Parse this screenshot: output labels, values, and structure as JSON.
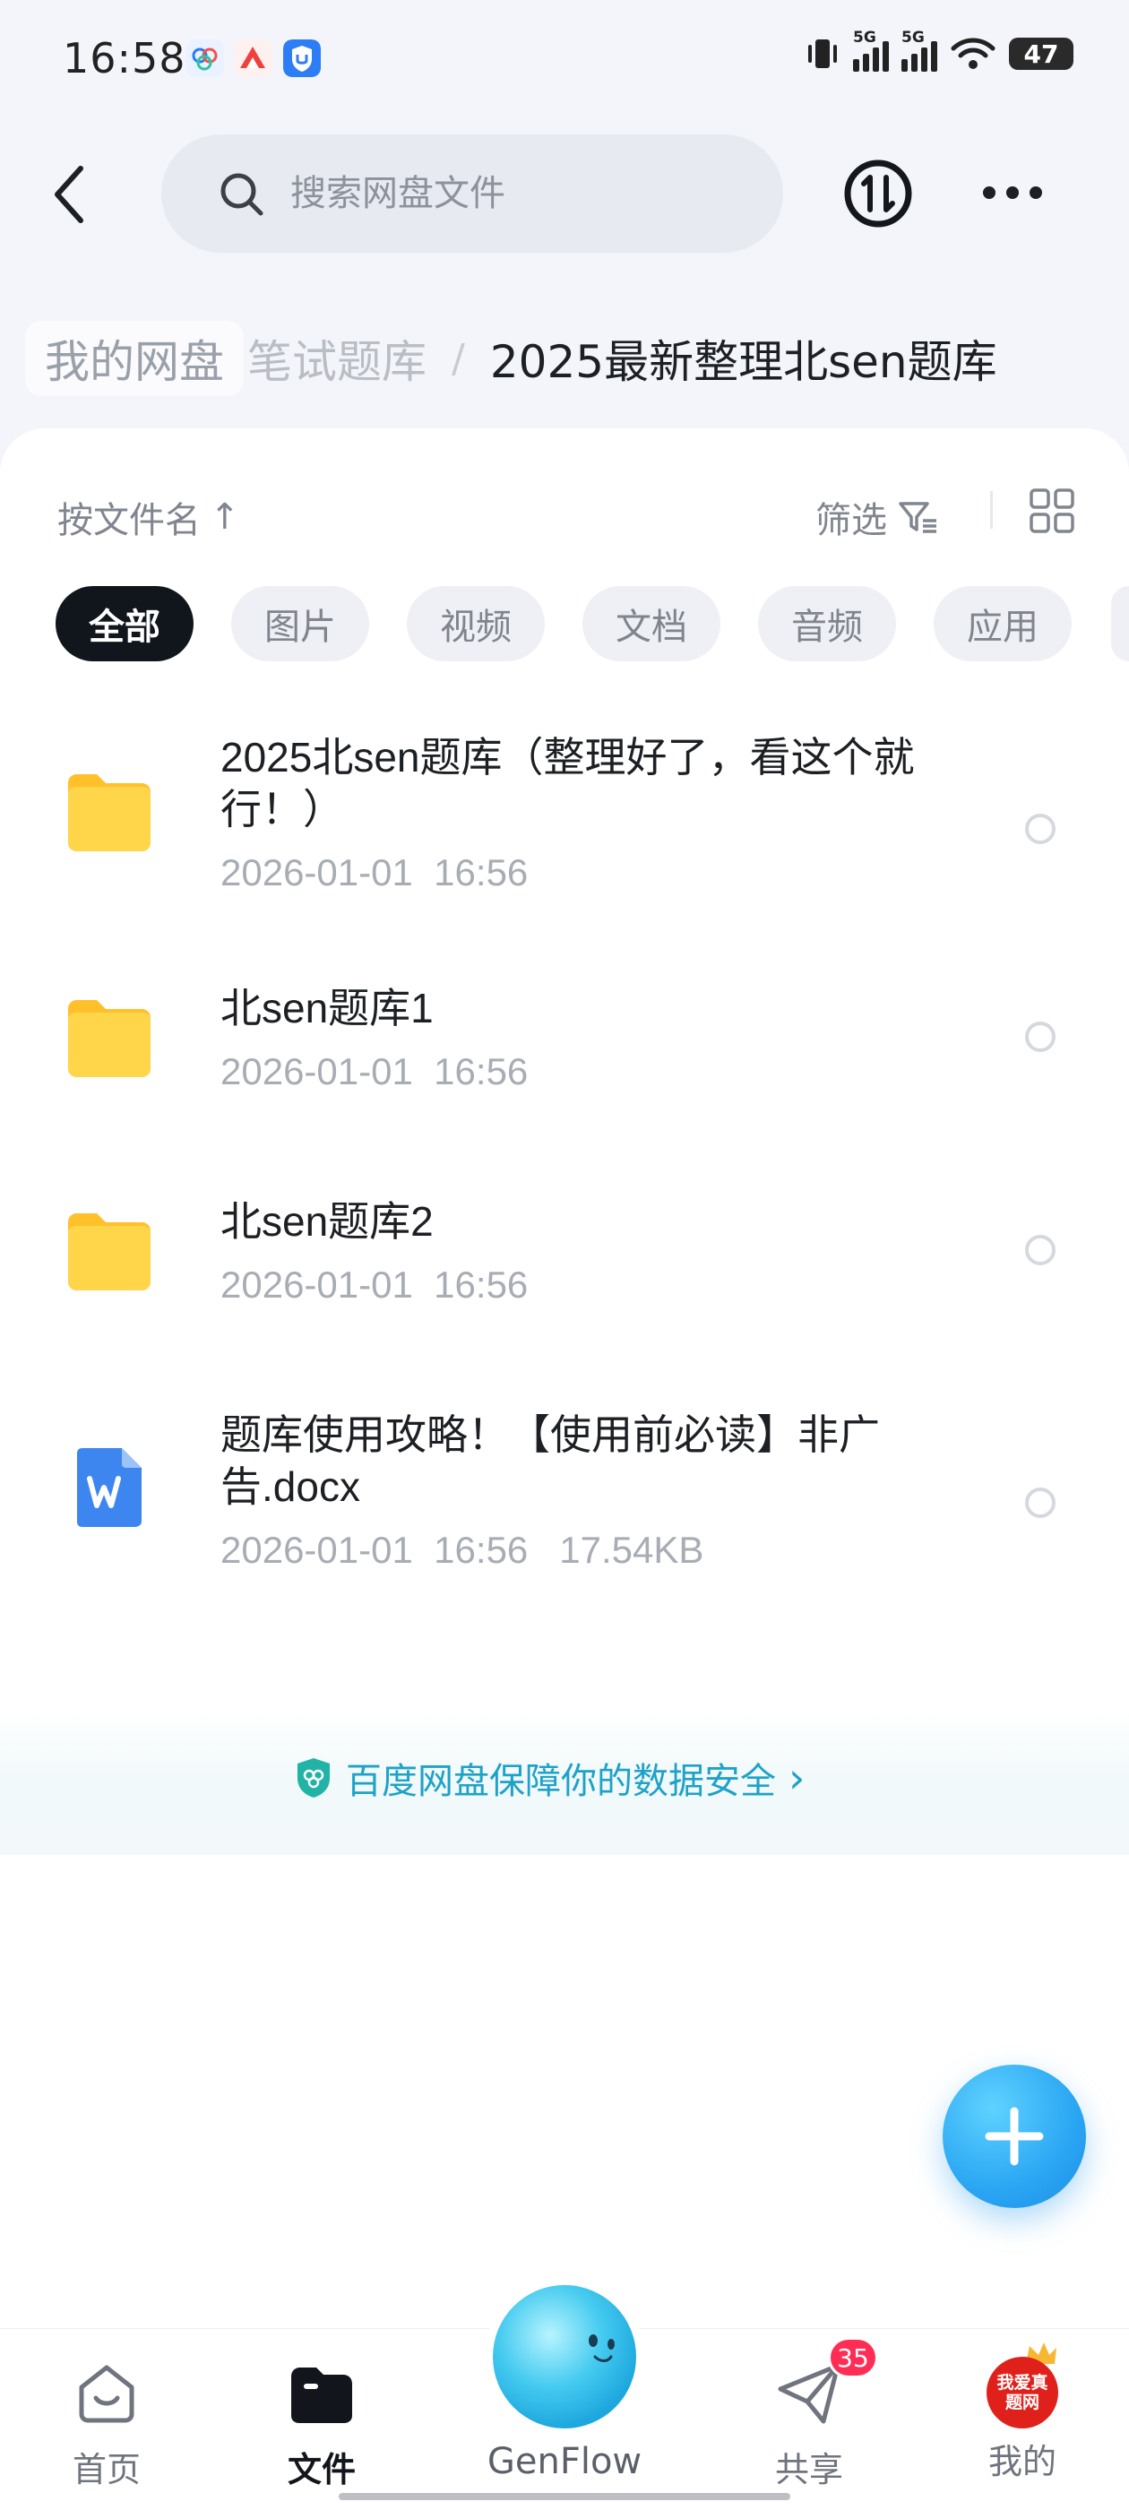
{
  "status_bar": {
    "time": "16:58",
    "app_icons": [
      "baidu-netdisk-icon",
      "mountain-app-icon",
      "shield-app-icon"
    ],
    "network_1": "5G",
    "network_2": "5G",
    "battery": "47"
  },
  "top_bar": {
    "search_placeholder": "搜索网盘文件"
  },
  "breadcrumb": {
    "root": "我的网盘",
    "middle": "笔试题库",
    "separator": "/",
    "current": "2025最新整理北sen题库"
  },
  "toolbar": {
    "sort_label": "按文件名",
    "sort_arrow": "↑",
    "filter_label": "筛选"
  },
  "filter_chips": [
    {
      "label": "全部",
      "active": true
    },
    {
      "label": "图片",
      "active": false
    },
    {
      "label": "视频",
      "active": false
    },
    {
      "label": "文档",
      "active": false
    },
    {
      "label": "音频",
      "active": false
    },
    {
      "label": "应用",
      "active": false
    }
  ],
  "files": [
    {
      "name": "2025北sen题库（整理好了，看这个就行！）",
      "meta": "2026-01-01  16:56",
      "type": "folder-icon"
    },
    {
      "name": "北sen题库1",
      "meta": "2026-01-01  16:56",
      "type": "folder-icon"
    },
    {
      "name": "北sen题库2",
      "meta": "2026-01-01  16:56",
      "type": "folder-icon"
    },
    {
      "name": "题库使用攻略！【使用前必读】非广告.docx",
      "meta": "2026-01-01  16:56   17.54KB",
      "type": "word-doc-icon"
    }
  ],
  "security_banner": {
    "text": "百度网盘保障你的数据安全",
    "arrow": "›"
  },
  "bottom_nav": {
    "items": [
      {
        "label": "首页",
        "active": false
      },
      {
        "label": "文件",
        "active": true
      },
      {
        "label": "GenFlow",
        "active": false
      },
      {
        "label": "共享",
        "active": false,
        "badge": "35"
      },
      {
        "label": "我的",
        "active": false,
        "avatar_text": "我爱真题网"
      }
    ]
  },
  "colors": {
    "accent": "#2aa6f3",
    "banner_text": "#1fa2c8",
    "badge": "#ff2d55",
    "folder": "#ffc935"
  }
}
